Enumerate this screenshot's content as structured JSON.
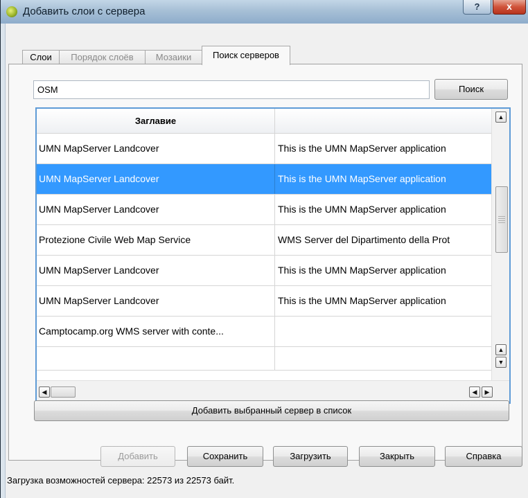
{
  "window": {
    "title": "Добавить слои с сервера",
    "help_label": "?",
    "close_label": "x"
  },
  "tabs": [
    {
      "label": "Слои",
      "enabled": true,
      "active": false
    },
    {
      "label": "Порядок слоёв",
      "enabled": false,
      "active": false
    },
    {
      "label": "Мозаики",
      "enabled": false,
      "active": false
    },
    {
      "label": "Поиск серверов",
      "enabled": true,
      "active": true
    }
  ],
  "search": {
    "value": "OSM",
    "button_label": "Поиск"
  },
  "table": {
    "columns": [
      "Заглавие",
      ""
    ],
    "selected_row": 1,
    "rows": [
      [
        "UMN MapServer Landcover",
        "This is the UMN MapServer application"
      ],
      [
        "UMN MapServer Landcover",
        "This is the UMN MapServer application"
      ],
      [
        "UMN MapServer Landcover",
        "This is the UMN MapServer application"
      ],
      [
        "Protezione Civile Web Map Service",
        "WMS Server del Dipartimento della Prot"
      ],
      [
        "UMN MapServer Landcover",
        "This is the UMN MapServer application"
      ],
      [
        "UMN MapServer Landcover",
        "This is the UMN MapServer application"
      ],
      [
        "Camptocamp.org WMS server with conte...",
        ""
      ]
    ]
  },
  "add_server_button": "Добавить выбранный сервер в список",
  "buttons": {
    "add": "Добавить",
    "save": "Сохранить",
    "load": "Загрузить",
    "close": "Закрыть",
    "help": "Справка"
  },
  "status": "Загрузка возможностей сервера: 22573 из 22573 байт.",
  "colors": {
    "selection": "#3399ff",
    "table_border": "#5e9bd6"
  },
  "icons": {
    "app": "qgis-icon",
    "scroll_up": "arrow-up-icon",
    "scroll_down": "arrow-down-icon",
    "scroll_left": "arrow-left-icon",
    "scroll_right": "arrow-right-icon"
  }
}
